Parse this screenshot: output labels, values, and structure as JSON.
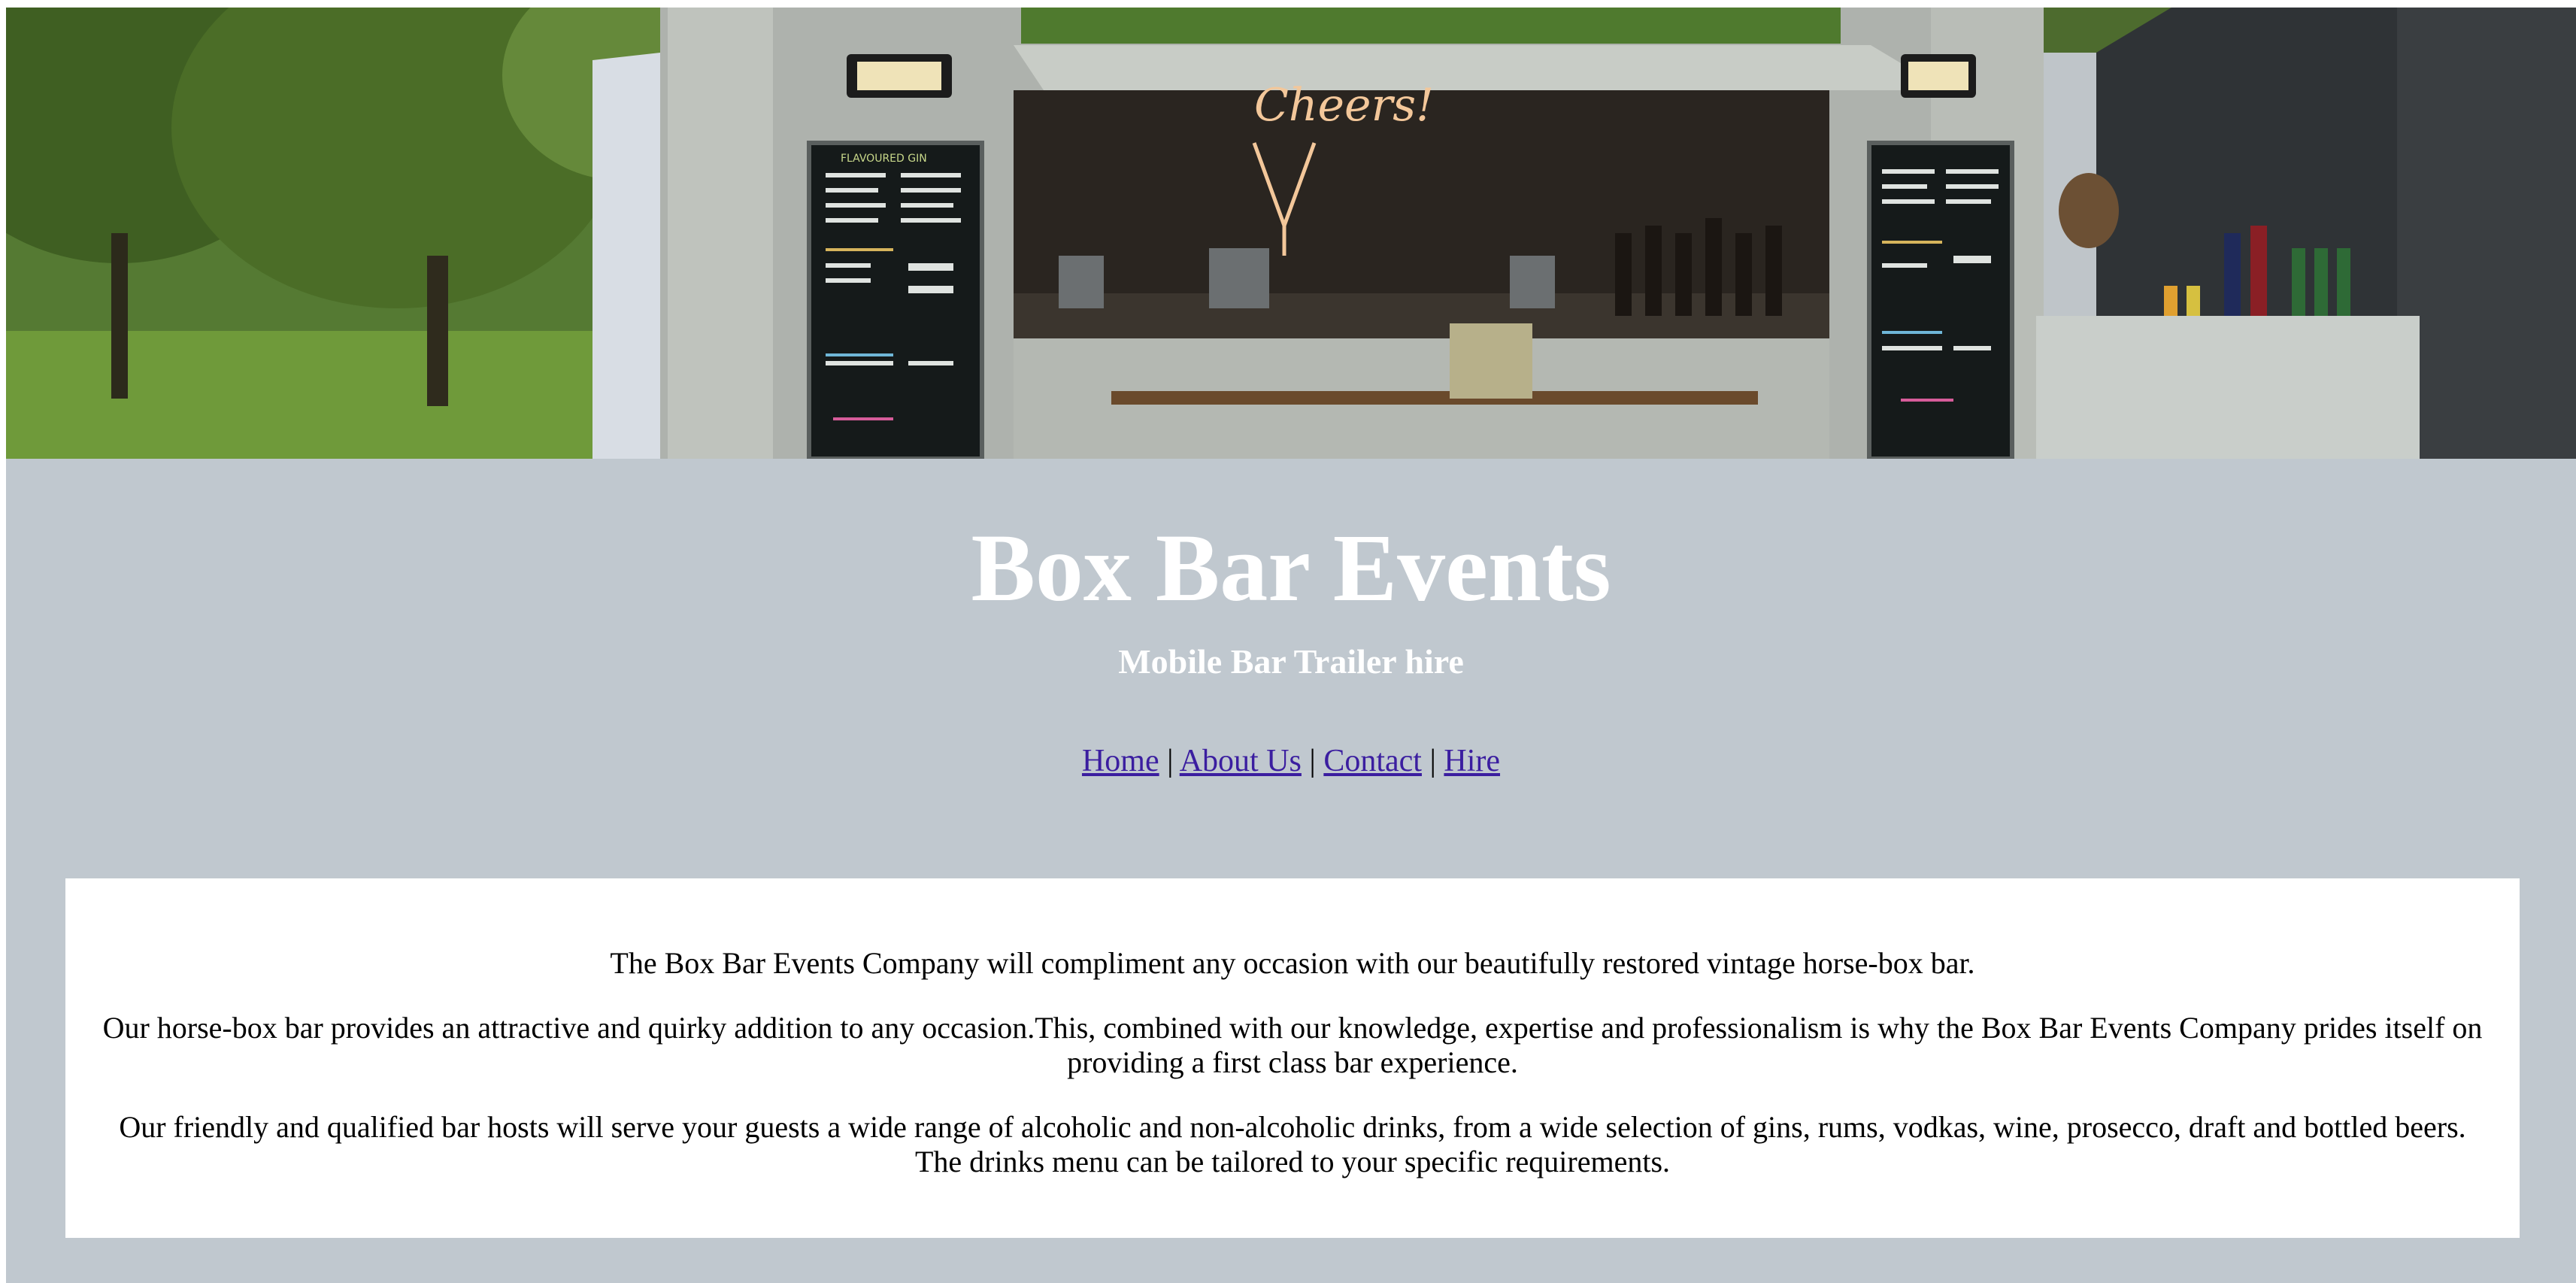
{
  "site": {
    "title": "Box Bar Events",
    "subtitle": "Mobile Bar Trailer hire"
  },
  "nav": {
    "items": [
      {
        "label": "Home"
      },
      {
        "label": "About Us"
      },
      {
        "label": "Contact"
      },
      {
        "label": "Hire"
      }
    ],
    "separator": "|"
  },
  "content": {
    "paragraphs": [
      "The Box Bar Events Company will compliment any occasion with our beautifully restored vintage horse-box bar.",
      "Our horse-box bar provides an attractive and quirky addition to any occasion.This, combined with our knowledge, expertise and professionalism is why the Box Bar Events Company prides itself on providing a first class bar experience.",
      "Our friendly and qualified bar hosts will serve your guests a wide range of alcoholic and non-alcoholic drinks, from a wide selection of gins, rums, vodkas, wine, prosecco, draft and bottled beers. The drinks menu can be tailored to your specific requirements."
    ]
  },
  "hero": {
    "alt": "",
    "menu_board_heading": "FLAVOURED GIN",
    "neon_sign": "Cheers!"
  },
  "colors": {
    "page_background": "#c0c8cf",
    "card_background": "#ffffff",
    "link": "#3b1ea0",
    "heading": "#ffffff"
  }
}
